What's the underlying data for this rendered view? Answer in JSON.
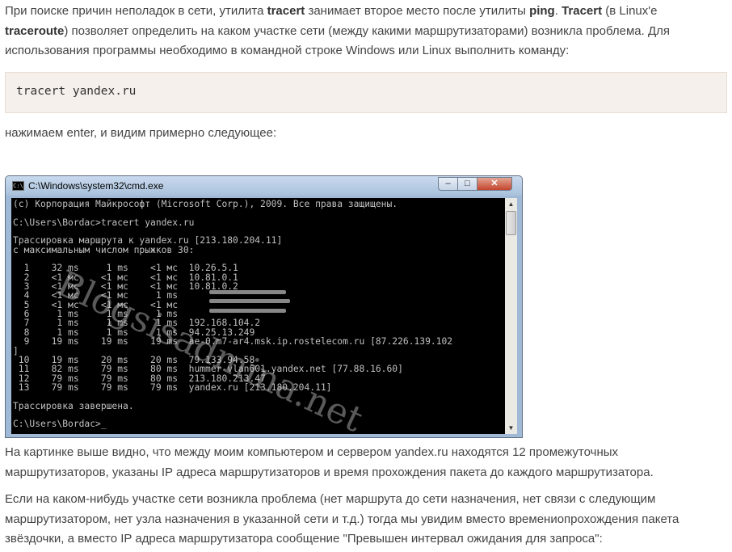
{
  "intro": {
    "t1": "При поиске причин неполадок в сети, утилита ",
    "b1": "tracert",
    "t2": " занимает второе место после утилиты ",
    "b2": "ping",
    "t3": ". ",
    "b3": "Tracert",
    "t4": " (в Linux'е ",
    "b4": "traceroute",
    "t5": ") позволяет определить на каком участке сети (между какими маршрутизаторами) возникла проблема. Для использования программы необходимо в командной строке Windows или Linux выполнить команду:"
  },
  "code_command": "tracert yandex.ru",
  "after_code": "нажимаем enter, и видим примерно следующее:",
  "cmd_window": {
    "title": "C:\\Windows\\system32\\cmd.exe",
    "icon_label": "C:\\",
    "minimize": "–",
    "maximize": "□",
    "close": "✕",
    "watermark": "Blogsisadmina.net",
    "lines": [
      "(c) Корпорация Майкрософт (Microsoft Corp.), 2009. Все права защищены.",
      "",
      "C:\\Users\\Bordac>tracert yandex.ru",
      "",
      "Трассировка маршрута к yandex.ru [213.180.204.11]",
      "с максимальным числом прыжков 30:",
      "",
      "  1    32 ms     1 ms    <1 мс  10.26.5.1",
      "  2    <1 мс    <1 мс    <1 мс  10.81.0.1",
      "  3    <1 мс    <1 мс    <1 мс  10.81.0.2",
      "  4    <1 мс    <1 мс     1 ms",
      "  5    <1 мс    <1 мс    <1 мс",
      "  6     1 ms     1 ms     1 ms",
      "  7     1 ms     1 ms     1 ms  192.168.104.2",
      "  8     1 ms     1 ms     1 ms  94.25.13.249",
      "  9    19 ms    19 ms    19 ms  ae-0.m7-ar4.msk.ip.rostelecom.ru [87.226.139.102",
      "]",
      " 10    19 ms    20 ms    20 ms  79.133.94.58",
      " 11    82 ms    79 ms    80 ms  hummer-vlan601.yandex.net [77.88.16.60]",
      " 12    79 ms    79 ms    80 ms  213.180.213.47",
      " 13    79 ms    79 ms    79 ms  yandex.ru [213.180.204.11]",
      "",
      "Трассировка завершена.",
      "",
      "C:\\Users\\Bordac>_"
    ],
    "scroll_up": "▲",
    "scroll_down": "▼"
  },
  "para_after_image": "На картинке выше видно, что между моим компьютером и сервером yandex.ru находятся 12 промежуточных маршрутизаторов, указаны IP адреса маршрутизаторов и время прохождения пакета до каждого маршрутизатора.",
  "para_problem": "Если на каком-нибудь участке сети возникла проблема (нет маршрута до сети назначения, нет связи с следующим маршрутизатором, нет узла назначения в указанной сети и т.д.) тогда мы увидим вместо времениоп­рохождения пакета звёздочки, а вместо IP адреса маршрутизатора сообщение \"Превышен интервал ожидания для запроса\":"
}
